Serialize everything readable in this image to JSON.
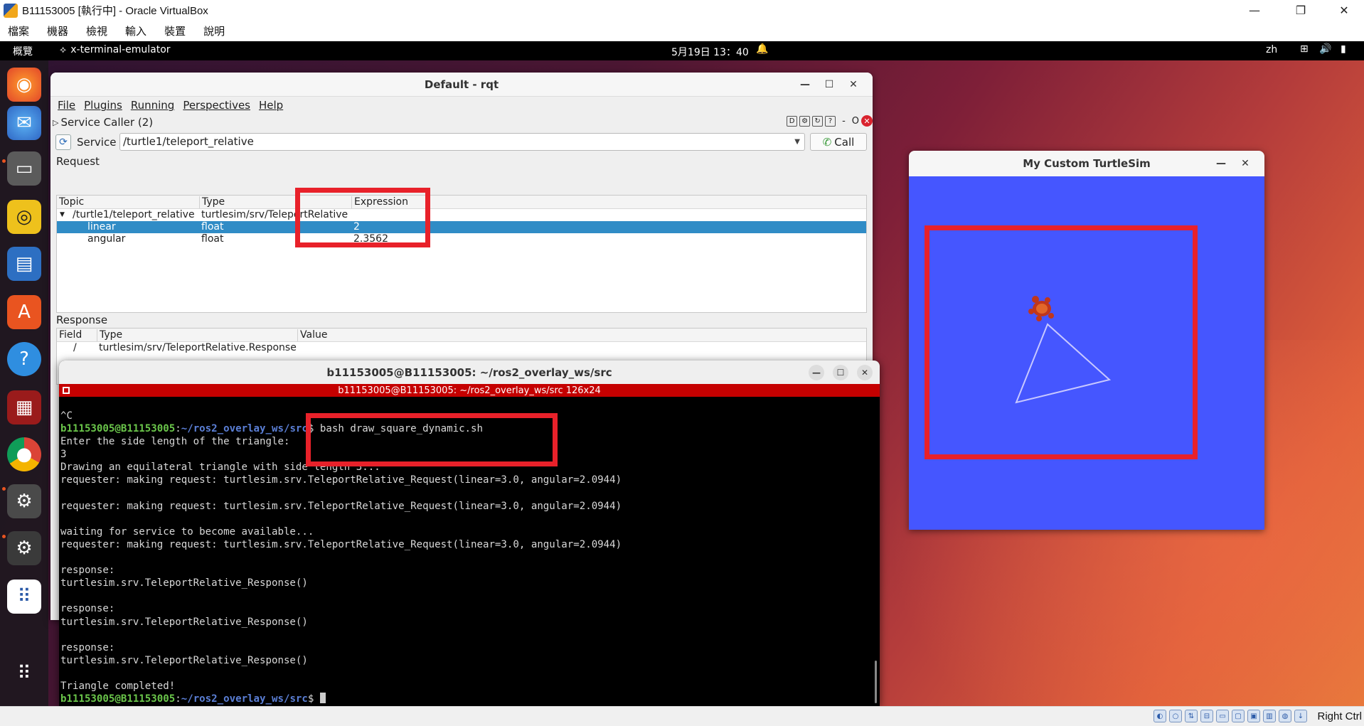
{
  "host": {
    "window_title": "B11153005 [執行中] - Oracle VirtualBox",
    "minimize": "—",
    "maximize": "❐",
    "close": "✕",
    "menu": [
      "檔案",
      "機器",
      "檢視",
      "輸入",
      "裝置",
      "說明"
    ],
    "host_key": "Right Ctrl"
  },
  "ubuntu_topbar": {
    "overview": "概覽",
    "app_name": "x-terminal-emulator",
    "clock": "5月19日 13：40",
    "lang": "zh"
  },
  "dock": {
    "items": [
      "firefox-icon",
      "thunderbird-icon",
      "files-icon",
      "rhythmbox-icon",
      "writer-icon",
      "app-center-icon",
      "help-icon",
      "rqt-icon",
      "chrome-icon",
      "settings-icon",
      "settings-icon-2",
      "show-apps-icon"
    ]
  },
  "rqt": {
    "title": "Default - rqt",
    "menu": [
      "File",
      "Plugins",
      "Running",
      "Perspectives",
      "Help"
    ],
    "plugin_title": "Service Caller (2)",
    "plugin_controls": {
      "d": "D",
      "dash": "-",
      "o": "O"
    },
    "service_label": "Service",
    "service_value": "/turtle1/teleport_relative",
    "call_label": "Call",
    "request_label": "Request",
    "request_headers": [
      "Topic",
      "Type",
      "Expression"
    ],
    "request_rows": [
      {
        "topic": "/turtle1/teleport_relative",
        "type": "turtlesim/srv/TeleportRelative",
        "expr": ""
      },
      {
        "topic": "linear",
        "type": "float",
        "expr": "2"
      },
      {
        "topic": "angular",
        "type": "float",
        "expr": "2.3562"
      }
    ],
    "response_label": "Response",
    "response_headers": [
      "Field",
      "Type",
      "Value"
    ],
    "response_rows": [
      {
        "field": "/",
        "type": "turtlesim/srv/TeleportRelative.Response",
        "value": ""
      }
    ]
  },
  "terminal": {
    "title": "b11153005@B11153005: ~/ros2_overlay_ws/src",
    "tab_title": "b11153005@B11153005: ~/ros2_overlay_ws/src 126x24",
    "prompt_user": "b11153005@B11153005",
    "prompt_path": "~/ros2_overlay_ws/src",
    "line_interrupt": "^C",
    "command": "bash draw_square_dynamic.sh",
    "line_ask": "Enter the side length of the triangle:",
    "line_input": "3",
    "line_drawing": "Drawing an equilateral triangle with side length 3...",
    "line_req": "requester: making request: turtlesim.srv.TeleportRelative_Request(linear=3.0, angular=2.0944)",
    "line_waiting": "waiting for service to become available...",
    "line_response": "response:",
    "line_response_obj": "turtlesim.srv.TeleportRelative_Response()",
    "line_done": "Triangle completed!"
  },
  "turtlesim": {
    "title": "My Custom TurtleSim",
    "bg_color": "#4556ff"
  },
  "colors": {
    "annotation": "#e8212a",
    "selection": "#308cc6",
    "terminal_red": "#c50000"
  }
}
